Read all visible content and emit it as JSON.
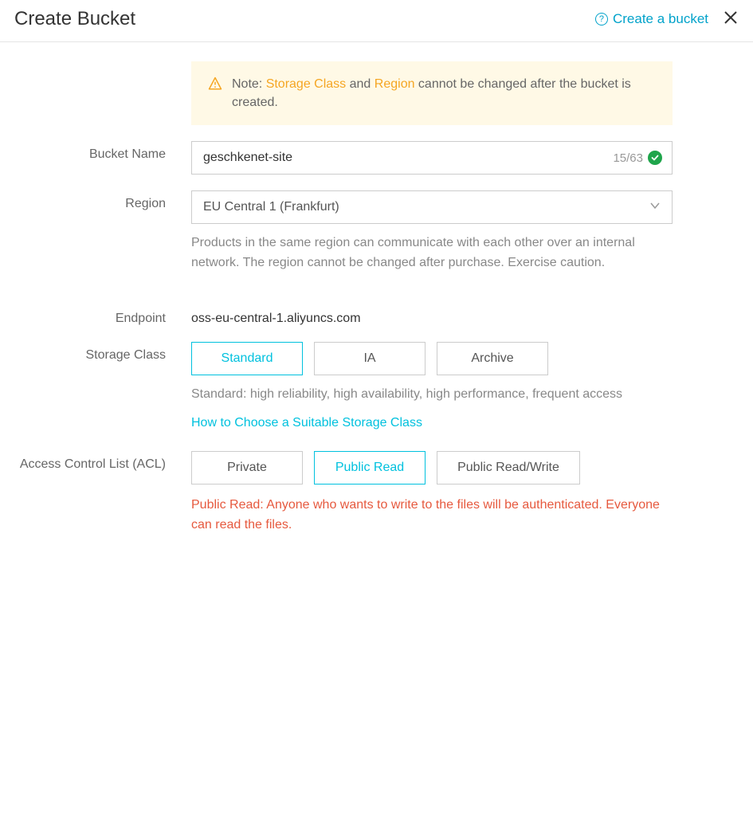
{
  "header": {
    "title": "Create Bucket",
    "help_link": "Create a bucket"
  },
  "note": {
    "prefix": "Note: ",
    "storage_class": "Storage Class",
    "and": " and ",
    "region": "Region",
    "suffix": " cannot be changed after the bucket is created."
  },
  "bucket_name": {
    "label": "Bucket Name",
    "value": "geschkenet-site",
    "counter": "15/63"
  },
  "region": {
    "label": "Region",
    "value": "EU Central 1 (Frankfurt)",
    "helper": "Products in the same region can communicate with each other over an internal network. The region cannot be changed after purchase. Exercise caution."
  },
  "endpoint": {
    "label": "Endpoint",
    "value": "oss-eu-central-1.aliyuncs.com"
  },
  "storage_class": {
    "label": "Storage Class",
    "options": {
      "standard": "Standard",
      "ia": "IA",
      "archive": "Archive"
    },
    "helper": "Standard: high reliability, high availability, high performance, frequent access",
    "link": "How to Choose a Suitable Storage Class"
  },
  "acl": {
    "label": "Access Control List (ACL)",
    "options": {
      "private": "Private",
      "public_read": "Public Read",
      "public_rw": "Public Read/Write"
    },
    "warning": "Public Read: Anyone who wants to write to the files will be authenticated. Everyone can read the files."
  }
}
